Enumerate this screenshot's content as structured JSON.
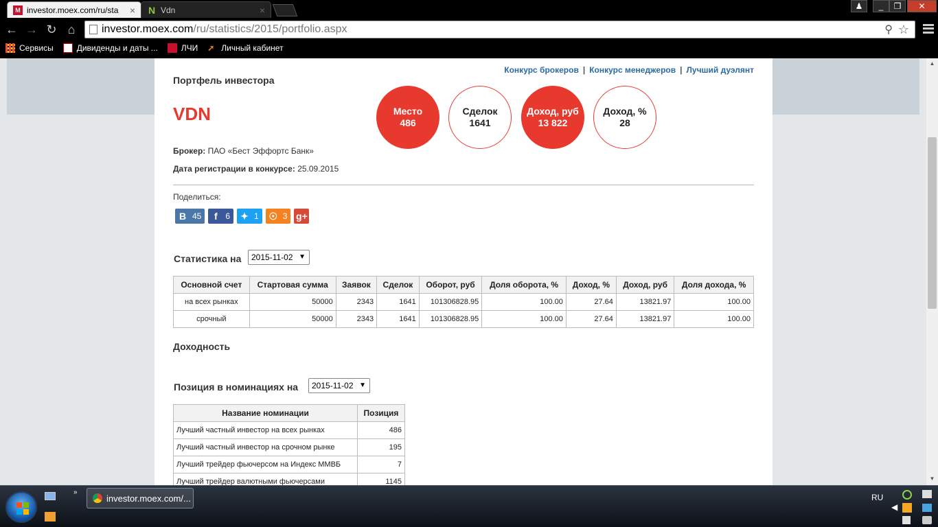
{
  "browser": {
    "tabs": [
      {
        "title": "investor.moex.com/ru/sta",
        "favicon": "moex-favicon-icon"
      },
      {
        "title": "Vdn",
        "favicon": "vdn-favicon-icon"
      }
    ],
    "url_host": "investor.moex.com",
    "url_path": "/ru/statistics/2015/portfolio.aspx",
    "bookmarks": [
      "Сервисы",
      "Дивиденды и даты ...",
      "ЛЧИ",
      "Личный кабинет"
    ]
  },
  "page": {
    "top_links": [
      "Конкурс брокеров",
      "Конкурс менеджеров",
      "Лучший дуэлянт"
    ],
    "title": "Портфель инвестора",
    "nick": "VDN",
    "circles": [
      {
        "label": "Место",
        "value": "486"
      },
      {
        "label": "Сделок",
        "value": "1641"
      },
      {
        "label": "Доход, руб",
        "value": "13 822"
      },
      {
        "label": "Доход, %",
        "value": "28"
      }
    ],
    "broker_label": "Брокер:",
    "broker_value": "ПАО «Бест Эффортс Банк»",
    "reg_label": "Дата регистрации в конкурсе:",
    "reg_value": "25.09.2015",
    "share_label": "Поделиться:",
    "socials": [
      {
        "name": "vk",
        "glyph": "B",
        "count": "45",
        "color": "#4a76a8"
      },
      {
        "name": "facebook",
        "glyph": "f",
        "count": "6",
        "color": "#3b5998"
      },
      {
        "name": "twitter",
        "glyph": "t",
        "count": "1",
        "color": "#1da1f2"
      },
      {
        "name": "odnoklassniki",
        "glyph": "ok",
        "count": "3",
        "color": "#f58220"
      },
      {
        "name": "google-plus",
        "glyph": "g+",
        "count": "",
        "color": "#d64a3a"
      }
    ],
    "stats_title": "Статистика на",
    "stats_date": "2015-11-02",
    "stats_table": {
      "headers": [
        "Основной счет",
        "Стартовая сумма",
        "Заявок",
        "Сделок",
        "Оборот, руб",
        "Доля оборота, %",
        "Доход, %",
        "Доход, руб",
        "Доля дохода, %"
      ],
      "rows": [
        [
          "на всех рынках",
          "50000",
          "2343",
          "1641",
          "101306828.95",
          "100.00",
          "27.64",
          "13821.97",
          "100.00"
        ],
        [
          "срочный",
          "50000",
          "2343",
          "1641",
          "101306828.95",
          "100.00",
          "27.64",
          "13821.97",
          "100.00"
        ]
      ]
    },
    "profit_title": "Доходность",
    "nom_title": "Позиция в номинациях на",
    "nom_date": "2015-11-02",
    "nom_table": {
      "headers": [
        "Название номинации",
        "Позиция"
      ],
      "rows": [
        [
          "Лучший частный инвестор на всех рынках",
          "486"
        ],
        [
          "Лучший частный инвестор на срочном рынке",
          "195"
        ],
        [
          "Лучший трейдер фьючерсом на Индекс ММВБ",
          "7"
        ],
        [
          "Лучший трейдер валютными фьючерсами",
          "1145"
        ]
      ]
    }
  },
  "taskbar": {
    "task_title": "investor.moex.com/...",
    "lang": "RU"
  },
  "colors": {
    "accent": "#e8392e",
    "link": "#2c6aa0"
  }
}
